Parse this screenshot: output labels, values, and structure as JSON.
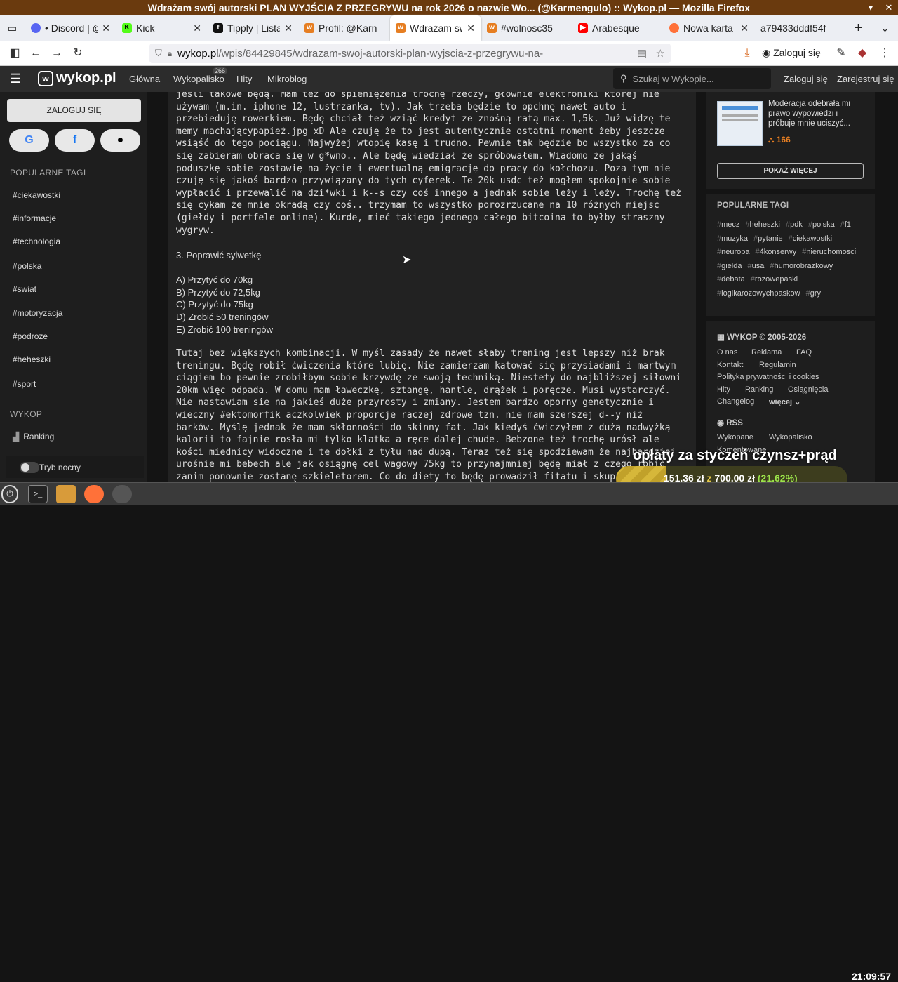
{
  "window": {
    "title": "Wdrażam swój autorski PLAN WYJŚCIA Z PRZEGRYWU na rok 2026 o nazwie Wo... (@Karmengulo) :: Wykop.pl — Mozilla Firefox"
  },
  "tabs": [
    {
      "label": "• Discord | @",
      "icon": "discord-icon",
      "color": "#5865f2"
    },
    {
      "label": "Kick",
      "icon": "kick-icon",
      "color": "#53fc18"
    },
    {
      "label": "Tipply | Lista",
      "icon": "tipply-icon",
      "color": "#111111"
    },
    {
      "label": "Profil: @Karn",
      "icon": "wykop-icon",
      "color": "#e67e22"
    },
    {
      "label": "Wdrażam sw",
      "icon": "wykop-icon",
      "color": "#e67e22"
    },
    {
      "label": "#wolnosc35",
      "icon": "wykop-icon",
      "color": "#e67e22"
    },
    {
      "label": "Arabesque",
      "icon": "youtube-icon",
      "color": "#ff0000"
    },
    {
      "label": "Nowa karta",
      "icon": "firefox-icon",
      "color": "#ff7139"
    },
    {
      "label": "a79433dddf54f",
      "icon": "",
      "color": ""
    }
  ],
  "urlbar": {
    "host": "wykop.pl",
    "path": "/wpis/84429845/wdrazam-swoj-autorski-plan-wyjscia-z-przegrywu-na-"
  },
  "browser": {
    "login_label": "Zaloguj się"
  },
  "header": {
    "logo": "wykop.pl",
    "nav": [
      "Główna",
      "Wykopalisko",
      "Hity",
      "Mikroblog"
    ],
    "wykopalisko_badge": "266",
    "search_placeholder": "Szukaj w Wykopie...",
    "login": "Zaloguj się",
    "register": "Zarejestruj się"
  },
  "left": {
    "login_button": "ZALOGUJ SIĘ",
    "popular_tags_header": "POPULARNE TAGI",
    "tags": [
      "#ciekawostki",
      "#informacje",
      "#technologia",
      "#polska",
      "#swiat",
      "#motoryzacja",
      "#podroze",
      "#heheszki",
      "#sport"
    ],
    "wykop_header": "WYKOP",
    "ranking": "Ranking",
    "night_mode": "Tryb nocny"
  },
  "post": {
    "para1": [
      "jeśli takowe będą. Mam też do spieniężenia trochę rzeczy, głównie elektroniki której nie",
      "używam (m.in. iphone 12, lustrzanka, tv). Jak trzeba będzie to opchnę nawet auto i",
      "przebieduję rowerkiem. Będę chciał też wziąć kredyt ze znośną ratą max. 1,5k. Już widzę te",
      "memy machającypapież.jpg xD Ale czuję że to jest autentycznie ostatni moment żeby jeszcze",
      "wsiąść do tego pociągu. Najwyżej wtopię kasę i trudno. Pewnie tak będzie bo wszystko za co",
      "się zabieram obraca się w g*wno.. Ale będę wiedział że spróbowałem. Wiadomo że jakąś",
      "poduszkę sobie zostawię na życie i ewentualną emigrację do pracy do kołchozu. Poza tym nie",
      "czuję się jakoś bardzo przywiązany do tych cyferek. Te 20k usdc też mogłem spokojnie sobie",
      "wypłacić i przewalić na dzi*wki i k--s czy coś innego a jednak sobie leży i leży. Trochę też",
      "się cykam że mnie okradą czy coś.. trzymam to wszystko porozrzucane na 10 różnych miejsc",
      "(giełdy i portfele online). Kurde, mieć takiego jednego całego bitcoina to byłby straszny",
      "wygryw."
    ],
    "section3_title": "3. Poprawić sylwetkę",
    "goals": [
      "A) Przytyć do 70kg",
      "B) Przytyć do 72,5kg",
      "C) Przytyć do 75kg",
      "D) Zrobić 50 treningów",
      "E) Zrobić 100 treningów"
    ],
    "para2": [
      "Tutaj bez większych kombinacji. W myśl zasady że nawet słaby trening jest lepszy niż brak",
      "treningu. Będę robił ćwiczenia które lubię. Nie zamierzam katować się przysiadami i martwym",
      "ciągiem bo pewnie zrobiłbym sobie krzywdę ze swoją techniką. Niestety do najbliższej siłowni",
      "20km więc odpada. W domu mam ławeczkę, sztangę, hantle, drążek i poręcze. Musi wystarczyć.",
      "Nie nastawiam sie na jakieś duże przyrosty i zmiany. Jestem bardzo oporny genetycznie i",
      "wieczny #ektomorfik aczkolwiek proporcje raczej zdrowe tzn. nie mam szerszej d--y niż",
      "barków. Myślę jednak że mam skłonności do skinny fat. Jak kiedyś ćwiczyłem z dużą nadwyżką",
      "kalorii to fajnie rosła mi tylko klatka a ręce dalej chude. Bebzone też trochę urósł ale",
      "kości miednicy widoczne i te dołki z tyłu nad dupą. Teraz też się spodziewam że najbardziej",
      "urośnie mi bebech ale jak osiągnę cel wagowy 75kg to przynajmniej będę miał z czego robić",
      "zanim ponownie zostanę szkieletorem. Co do diety to będę prowadził fitatu i skupię się"
    ]
  },
  "right": {
    "card_text": "Moderacja odebrała mi prawo wypowiedzi i próbuje mnie uciszyć...",
    "card_votes": "166",
    "show_more": "POKAŻ WIĘCEJ",
    "popular_tags_header": "POPULARNE TAGI",
    "tags": [
      "mecz",
      "heheszki",
      "pdk",
      "polska",
      "f1",
      "muzyka",
      "pytanie",
      "ciekawostki",
      "neuropa",
      "4konserwy",
      "nieruchomosci",
      "gielda",
      "usa",
      "humorobrazkowy",
      "debata",
      "rozowepaski",
      "logikarozowychpaskow",
      "gry"
    ],
    "footer_header": "WYKOP © 2005-2026",
    "footer_links": [
      "O nas",
      "Reklama",
      "FAQ",
      "Kontakt",
      "Regulamin",
      "Polityka prywatności i cookies",
      "Hity",
      "Ranking",
      "Osiągnięcia",
      "Changelog",
      "więcej"
    ],
    "rss_header": "RSS",
    "rss_links": [
      "Wykopane",
      "Wykopalisko",
      "Komentowane"
    ]
  },
  "overlay": {
    "title": "opłaty za styczeń czynsz+prąd",
    "current": "151,36 zł",
    "of": "z",
    "goal": "700,00 zł",
    "percent": "(21.62%)",
    "fraction": 0.2162
  },
  "taskbar": {
    "clock": "21:09:57"
  }
}
